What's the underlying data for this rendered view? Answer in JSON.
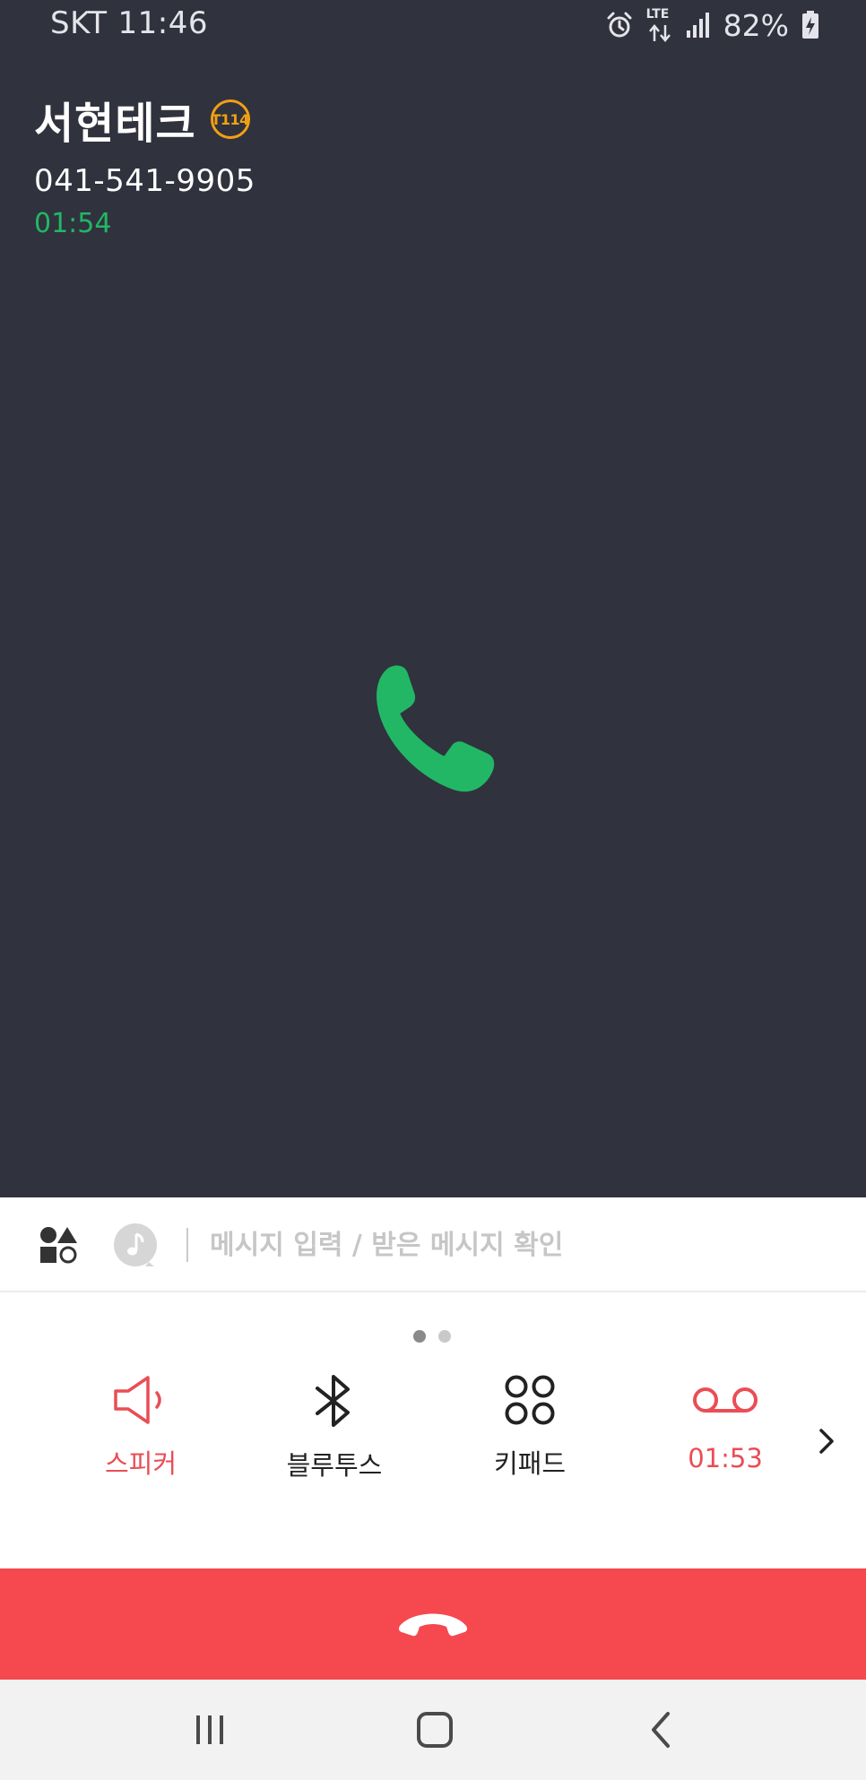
{
  "status_bar": {
    "carrier": "SKT",
    "time": "11:46",
    "network": "LTE",
    "battery": "82%",
    "icons": [
      "alarm-icon",
      "lte-data-icon",
      "signal-icon",
      "battery-charging-icon"
    ]
  },
  "caller": {
    "name": "서현테크",
    "badge": "T114",
    "number": "041-541-9905",
    "duration": "01:54"
  },
  "message": {
    "placeholder": "메시지 입력 / 받은 메시지 확인",
    "value": ""
  },
  "pager": {
    "current_page": 1,
    "total_pages": 2
  },
  "controls": [
    {
      "label": "스피커",
      "icon": "speaker-icon",
      "color": "#ea4d55"
    },
    {
      "label": "블루투스",
      "icon": "bluetooth-icon",
      "color": "#222222"
    },
    {
      "label": "키패드",
      "icon": "keypad-icon",
      "color": "#222222"
    },
    {
      "label": "01:53",
      "icon": "voicemail-record-icon",
      "color": "#ea4d55"
    }
  ],
  "colors": {
    "background": "#30323e",
    "accent_green": "#22b765",
    "end_call_red": "#f5484f",
    "badge_orange": "#f2a012",
    "active_red": "#ea4d55"
  },
  "nav": {
    "icons": [
      "recent-apps-icon",
      "home-icon",
      "back-icon"
    ]
  }
}
